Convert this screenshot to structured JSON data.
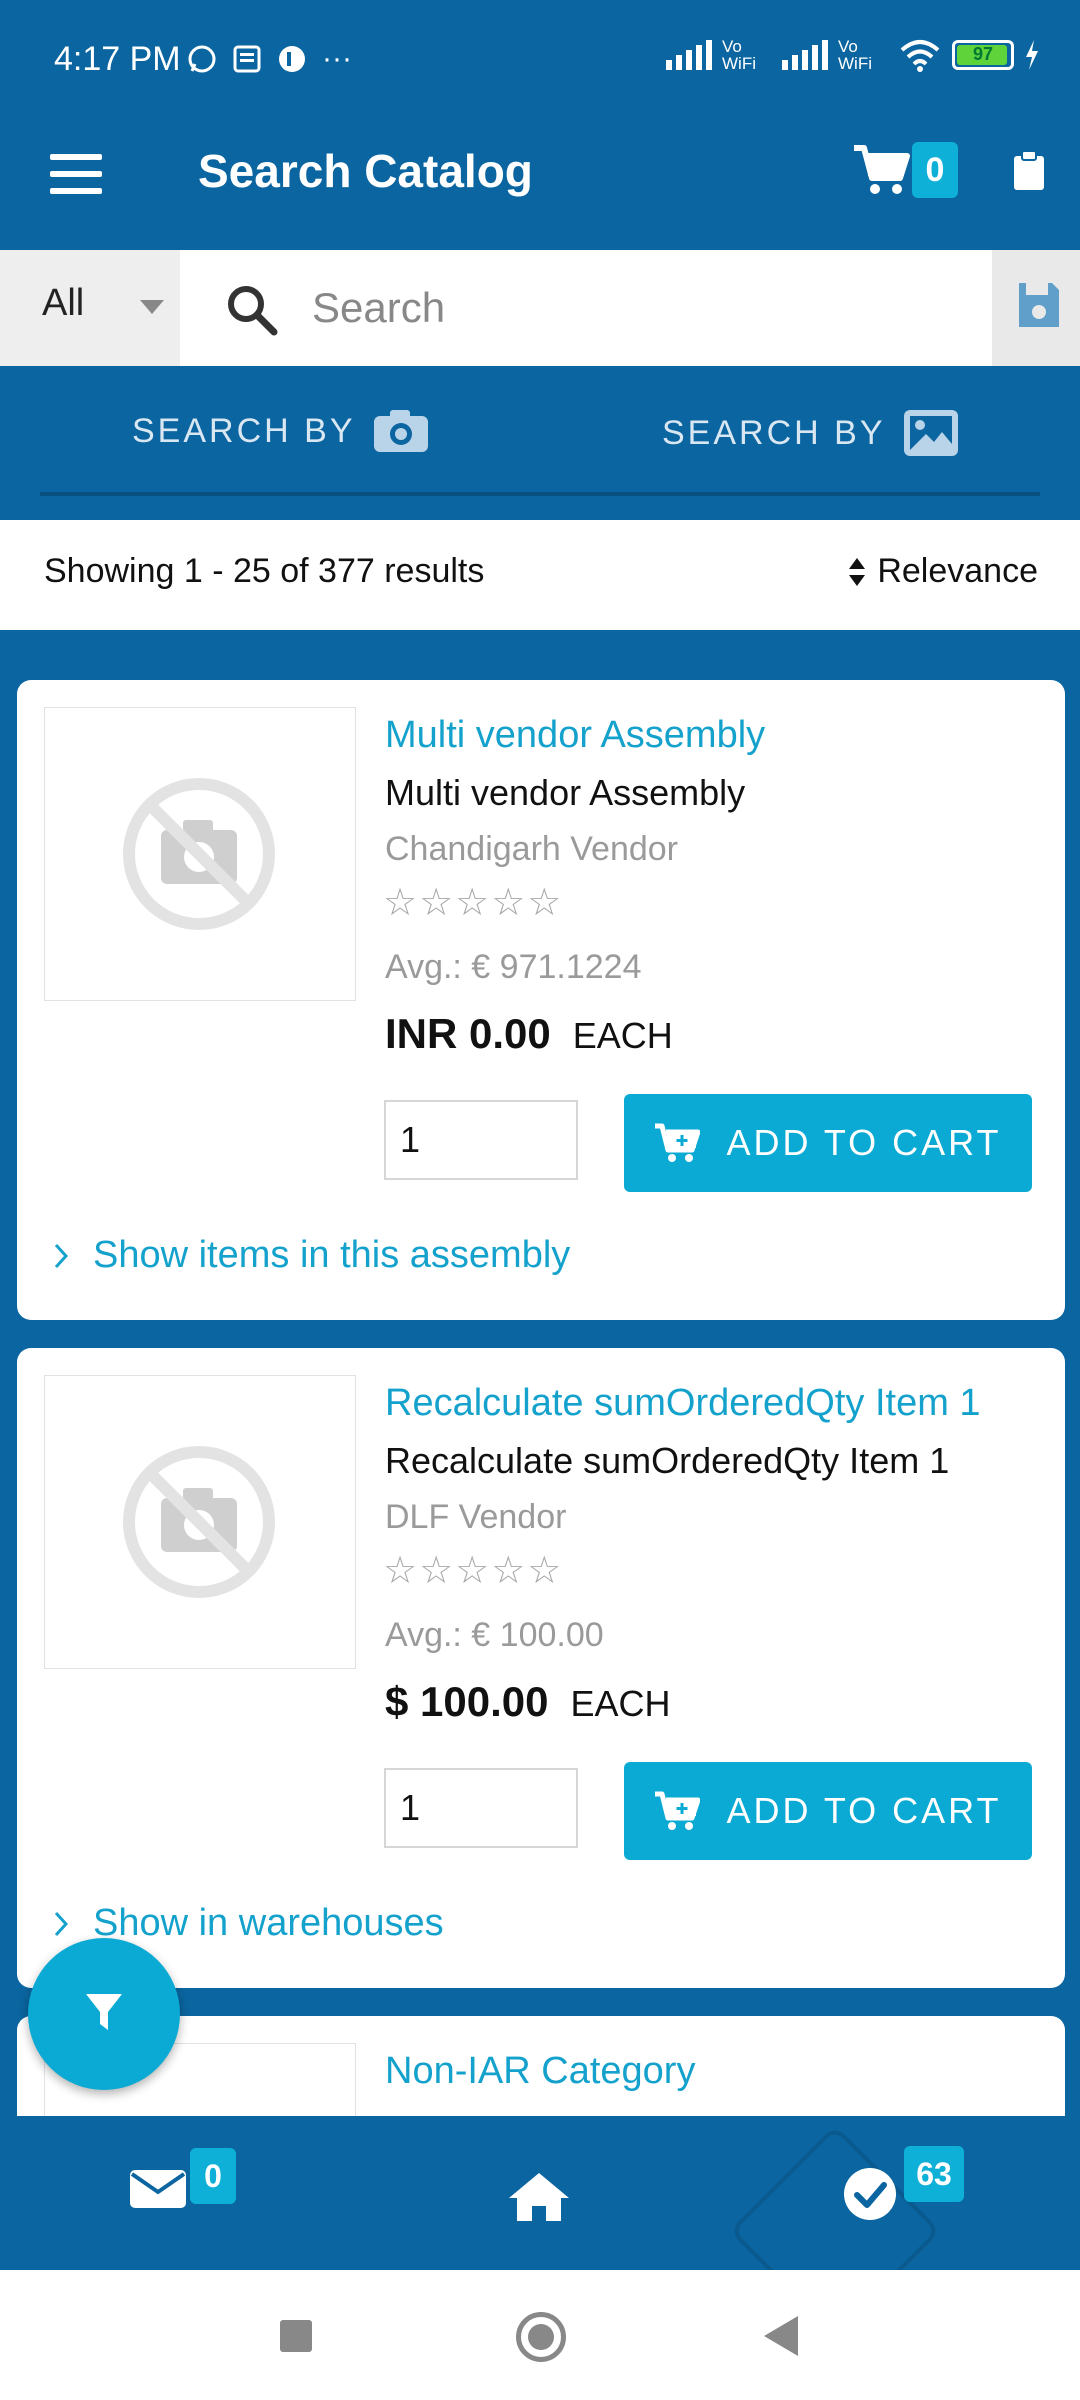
{
  "status_bar": {
    "time": "4:17 PM",
    "notification_icons": [
      "whatsapp-icon",
      "news-icon",
      "app-icon",
      "more-dots-icon"
    ],
    "more": "···",
    "vowifi_1": "Vo WiFi",
    "vowifi_2": "Vo WiFi",
    "battery": "97"
  },
  "app_bar": {
    "title": "Search Catalog",
    "cart_count": "0"
  },
  "search": {
    "scope": "All",
    "placeholder": "Search"
  },
  "search_by": {
    "camera_label": "SEARCH BY",
    "image_label": "SEARCH BY"
  },
  "results": {
    "summary": "Showing 1 - 25 of 377 results",
    "sort_label": "Relevance"
  },
  "products": [
    {
      "link": "Multi vendor Assembly",
      "name": "Multi vendor Assembly",
      "vendor": "Chandigarh Vendor",
      "stars": "☆☆☆☆☆",
      "avg": "Avg.: € 971.1224",
      "price": "INR 0.00",
      "unit": "EACH",
      "qty": "1",
      "add_label": "ADD TO CART",
      "more": "Show items in this assembly"
    },
    {
      "link": "Recalculate sumOrderedQty Item 1",
      "name": "Recalculate sumOrderedQty Item 1",
      "vendor": "DLF Vendor",
      "stars": "☆☆☆☆☆",
      "avg": "Avg.: € 100.00",
      "price": "$ 100.00",
      "unit": "EACH",
      "qty": "1",
      "add_label": "ADD TO CART",
      "more": "Show in warehouses"
    },
    {
      "link": "Non-IAR Category"
    }
  ],
  "bottom_nav": {
    "mail_count": "0",
    "tasks_count": "63"
  },
  "colors": {
    "brand": "#0b65a0",
    "accent": "#0aaad4",
    "link": "#14a2cd"
  }
}
